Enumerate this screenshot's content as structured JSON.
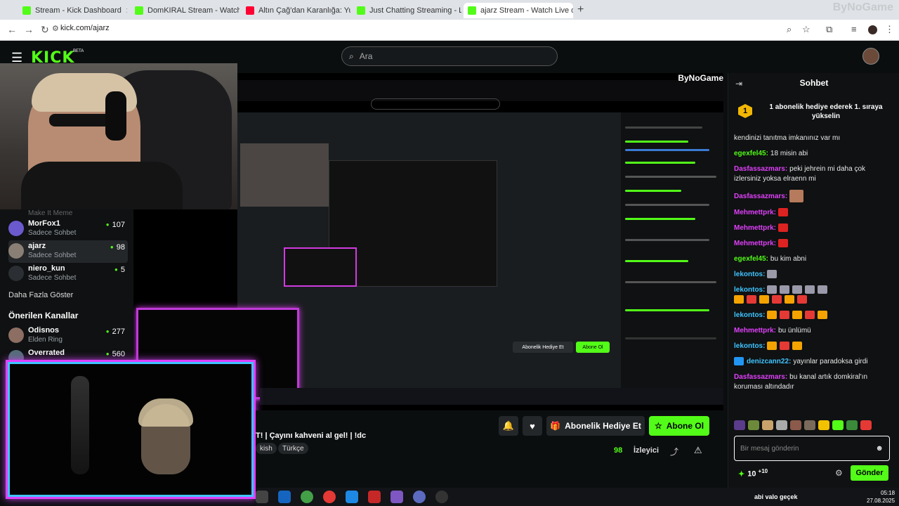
{
  "browser": {
    "tabs": [
      {
        "title": "Stream - Kick Dashboard",
        "color": "#53fc18"
      },
      {
        "title": "DomKIRAL Stream - Watch Live",
        "color": "#53fc18"
      },
      {
        "title": "Altın Çağ'dan Karanlığa: Yuga S",
        "color": "#ff0033"
      },
      {
        "title": "Just Chatting Streaming - Live S",
        "color": "#53fc18"
      },
      {
        "title": "ajarz Stream - Watch Live o",
        "color": "#53fc18"
      }
    ],
    "new_tab": "+",
    "corner_logo": "ByNoGame",
    "url": "kick.com/ajarz"
  },
  "header": {
    "logo": "KICK",
    "logo_badge": "BETA",
    "search_placeholder": "Ara"
  },
  "sidebar": {
    "faded_item": "Make It Meme",
    "followed": [
      {
        "name": "MorFox1",
        "status": "Sadece Sohbet",
        "viewers": "107",
        "avatar": "#6a5acd"
      },
      {
        "name": "ajarz",
        "status": "Sadece Sohbet",
        "viewers": "98",
        "avatar": "#8a7f74"
      },
      {
        "name": "niero_kun",
        "status": "Sadece Sohbet",
        "viewers": "5",
        "avatar": "#2b2f33"
      }
    ],
    "more_link": "Daha Fazla Göster",
    "recommended_header": "Önerilen Kanallar",
    "recommended": [
      {
        "name": "Odisnos",
        "status": "Elden Ring",
        "viewers": "277",
        "avatar": "#8d6e63"
      },
      {
        "name": "Overrated",
        "status": "",
        "viewers": "560",
        "avatar": "#546e7a"
      }
    ]
  },
  "stream_overlay": {
    "corner_logo": "ByNoGame",
    "inner_gift": "Abonelik Hediye Et",
    "inner_subscribe": "Abone Ol"
  },
  "stream_info": {
    "title": "T! | Çayını kahveni al gel! | !dc",
    "tags": [
      "kish",
      "Türkçe"
    ],
    "gift_button": "Abonelik Hediye Et",
    "subscribe_button": "Abone Ol",
    "viewers": "98",
    "viewers_label": "İzleyici"
  },
  "chat": {
    "title": "Sohbet",
    "promo": "1 abonelik hediye ederek 1. sıraya yükselin",
    "promo_rank": "1",
    "messages": [
      {
        "user": "",
        "color": "#fff",
        "text": "kendinizi tanıtma imkanınız var mı"
      },
      {
        "user": "egexfel45:",
        "color": "#53fc18",
        "text": "18 misin abi"
      },
      {
        "user": "Dasfassazmars:",
        "color": "#e040fb",
        "text": "peki jehrein mi daha çok izlersiniz yoksa elraenn mi"
      },
      {
        "user": "Dasfassazmars:",
        "color": "#e040fb",
        "text": ""
      },
      {
        "user": "Mehmettprk:",
        "color": "#e040fb",
        "text": ""
      },
      {
        "user": "Mehmettprk:",
        "color": "#e040fb",
        "text": ""
      },
      {
        "user": "Mehmettprk:",
        "color": "#e040fb",
        "text": ""
      },
      {
        "user": "egexfel45:",
        "color": "#53fc18",
        "text": "bu kim abni"
      },
      {
        "user": "lekontos:",
        "color": "#40c4ff",
        "text": ""
      },
      {
        "user": "lekontos:",
        "color": "#40c4ff",
        "text": ""
      },
      {
        "user": "lekontos:",
        "color": "#40c4ff",
        "text": ""
      },
      {
        "user": "Mehmettprk:",
        "color": "#e040fb",
        "text": "bu ünlümü"
      },
      {
        "user": "lekontos:",
        "color": "#40c4ff",
        "text": ""
      },
      {
        "user": "denizcann22:",
        "color": "#40c4ff",
        "text": "yayınlar paradoksa girdi"
      },
      {
        "user": "Dasfassazmars:",
        "color": "#e040fb",
        "text": "bu kanal artık domkiral'ın koruması altındadır"
      }
    ],
    "input_placeholder": "Bir mesaj gönderin",
    "points": "10",
    "points_plus": "+10",
    "send_button": "Gönder"
  },
  "taskbar": {
    "tray_text": "abi valo geçek",
    "time": "05:18",
    "date": "27.08.2025"
  }
}
